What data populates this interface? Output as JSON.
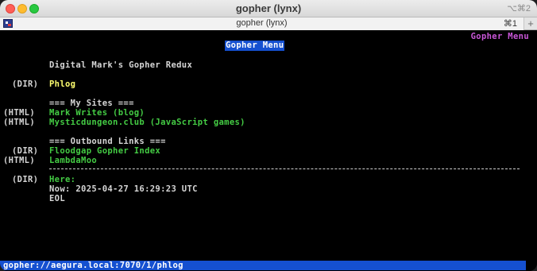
{
  "window": {
    "title": "gopher (lynx)",
    "shortcut": "⌥⌘2"
  },
  "tab": {
    "label": "gopher (lynx)",
    "shortcut": "⌘1",
    "new_tab_symbol": "+"
  },
  "page": {
    "corner_title": "Gopher Menu",
    "heading": "Gopher Menu",
    "intro": "Digital Mark's Gopher Redux",
    "phlog": {
      "type": "(DIR)",
      "label": "Phlog"
    },
    "my_sites_header": "=== My Sites ===",
    "my_sites": [
      {
        "type": "(HTML)",
        "label": "Mark Writes (blog)"
      },
      {
        "type": "(HTML)",
        "label": "Mysticdungeon.club (JavaScript games)"
      }
    ],
    "outbound_header": "=== Outbound Links ===",
    "outbound": [
      {
        "type": "(DIR)",
        "label": "Floodgap Gopher Index"
      },
      {
        "type": "(HTML)",
        "label": "LambdaMoo"
      }
    ],
    "here": {
      "type": "(DIR)",
      "label": "Here:"
    },
    "now_line": "Now: 2025-04-27 16:29:23 UTC",
    "eol": "EOL"
  },
  "status": {
    "url": "gopher://aegura.local:7070/1/phlog"
  },
  "colors": {
    "link": "#44cc44",
    "selected_link": "#ffff70",
    "highlight": "#1550d0",
    "title": "#c957d8"
  }
}
